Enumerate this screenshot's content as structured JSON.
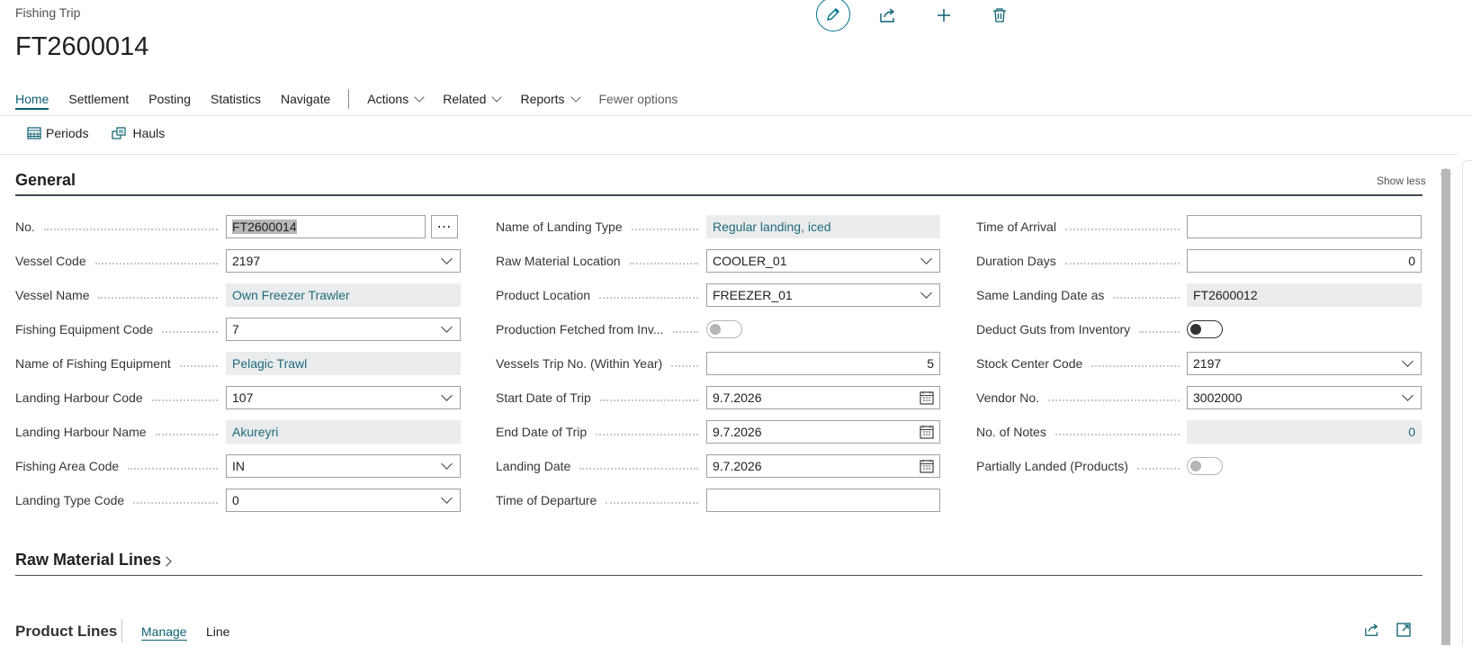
{
  "header": {
    "caption": "Fishing Trip",
    "title": "FT2600014"
  },
  "top_actions": [
    "edit-icon",
    "share-icon",
    "new-icon",
    "delete-icon"
  ],
  "ribbon": {
    "tabs": [
      "Home",
      "Settlement",
      "Posting",
      "Statistics",
      "Navigate"
    ],
    "menus": [
      "Actions",
      "Related",
      "Reports"
    ],
    "fewer_options": "Fewer options"
  },
  "subbar": {
    "periods": "Periods",
    "hauls": "Hauls"
  },
  "general": {
    "title": "General",
    "show_less": "Show less",
    "col1": [
      {
        "label": "No.",
        "value": "FT2600014",
        "type": "text-assist"
      },
      {
        "label": "Vessel Code",
        "value": "2197",
        "type": "dropdown"
      },
      {
        "label": "Vessel Name",
        "value": "Own Freezer Trawler",
        "type": "readonly"
      },
      {
        "label": "Fishing Equipment Code",
        "value": "7",
        "type": "dropdown"
      },
      {
        "label": "Name of Fishing Equipment",
        "value": "Pelagic Trawl",
        "type": "readonly"
      },
      {
        "label": "Landing Harbour Code",
        "value": "107",
        "type": "dropdown"
      },
      {
        "label": "Landing Harbour Name",
        "value": "Akureyri",
        "type": "readonly"
      },
      {
        "label": "Fishing Area Code",
        "value": "IN",
        "type": "dropdown"
      },
      {
        "label": "Landing Type Code",
        "value": "0",
        "type": "dropdown"
      }
    ],
    "col2": [
      {
        "label": "Name of Landing Type",
        "value": "Regular landing, iced",
        "type": "readonly"
      },
      {
        "label": "Raw Material Location",
        "value": "COOLER_01",
        "type": "dropdown"
      },
      {
        "label": "Product Location",
        "value": "FREEZER_01",
        "type": "dropdown"
      },
      {
        "label": "Production Fetched from Inv...",
        "value": "",
        "type": "toggle-disabled"
      },
      {
        "label": "Vessels Trip No. (Within Year)",
        "value": "5",
        "type": "number"
      },
      {
        "label": "Start Date of Trip",
        "value": "9.7.2026",
        "type": "date"
      },
      {
        "label": "End Date of Trip",
        "value": "9.7.2026",
        "type": "date"
      },
      {
        "label": "Landing Date",
        "value": "9.7.2026",
        "type": "date"
      },
      {
        "label": "Time of Departure",
        "value": "",
        "type": "text"
      }
    ],
    "col3": [
      {
        "label": "Time of Arrival",
        "value": "",
        "type": "text"
      },
      {
        "label": "Duration Days",
        "value": "0",
        "type": "number"
      },
      {
        "label": "Same Landing Date as",
        "value": "FT2600012",
        "type": "readonly-dark"
      },
      {
        "label": "Deduct Guts from Inventory",
        "value": "",
        "type": "toggle"
      },
      {
        "label": "Stock Center Code",
        "value": "2197",
        "type": "dropdown"
      },
      {
        "label": "Vendor No.",
        "value": "3002000",
        "type": "dropdown"
      },
      {
        "label": "No. of Notes",
        "value": "0",
        "type": "readonly-number"
      },
      {
        "label": "Partially Landed (Products)",
        "value": "",
        "type": "toggle-disabled"
      }
    ]
  },
  "raw_material_lines": {
    "title": "Raw Material Lines"
  },
  "product_lines": {
    "title": "Product Lines",
    "manage": "Manage",
    "line": "Line"
  },
  "colors": {
    "accent": "#0b5f70",
    "readonly_bg": "#eaeced",
    "readonly_text": "#1f6a7a"
  }
}
